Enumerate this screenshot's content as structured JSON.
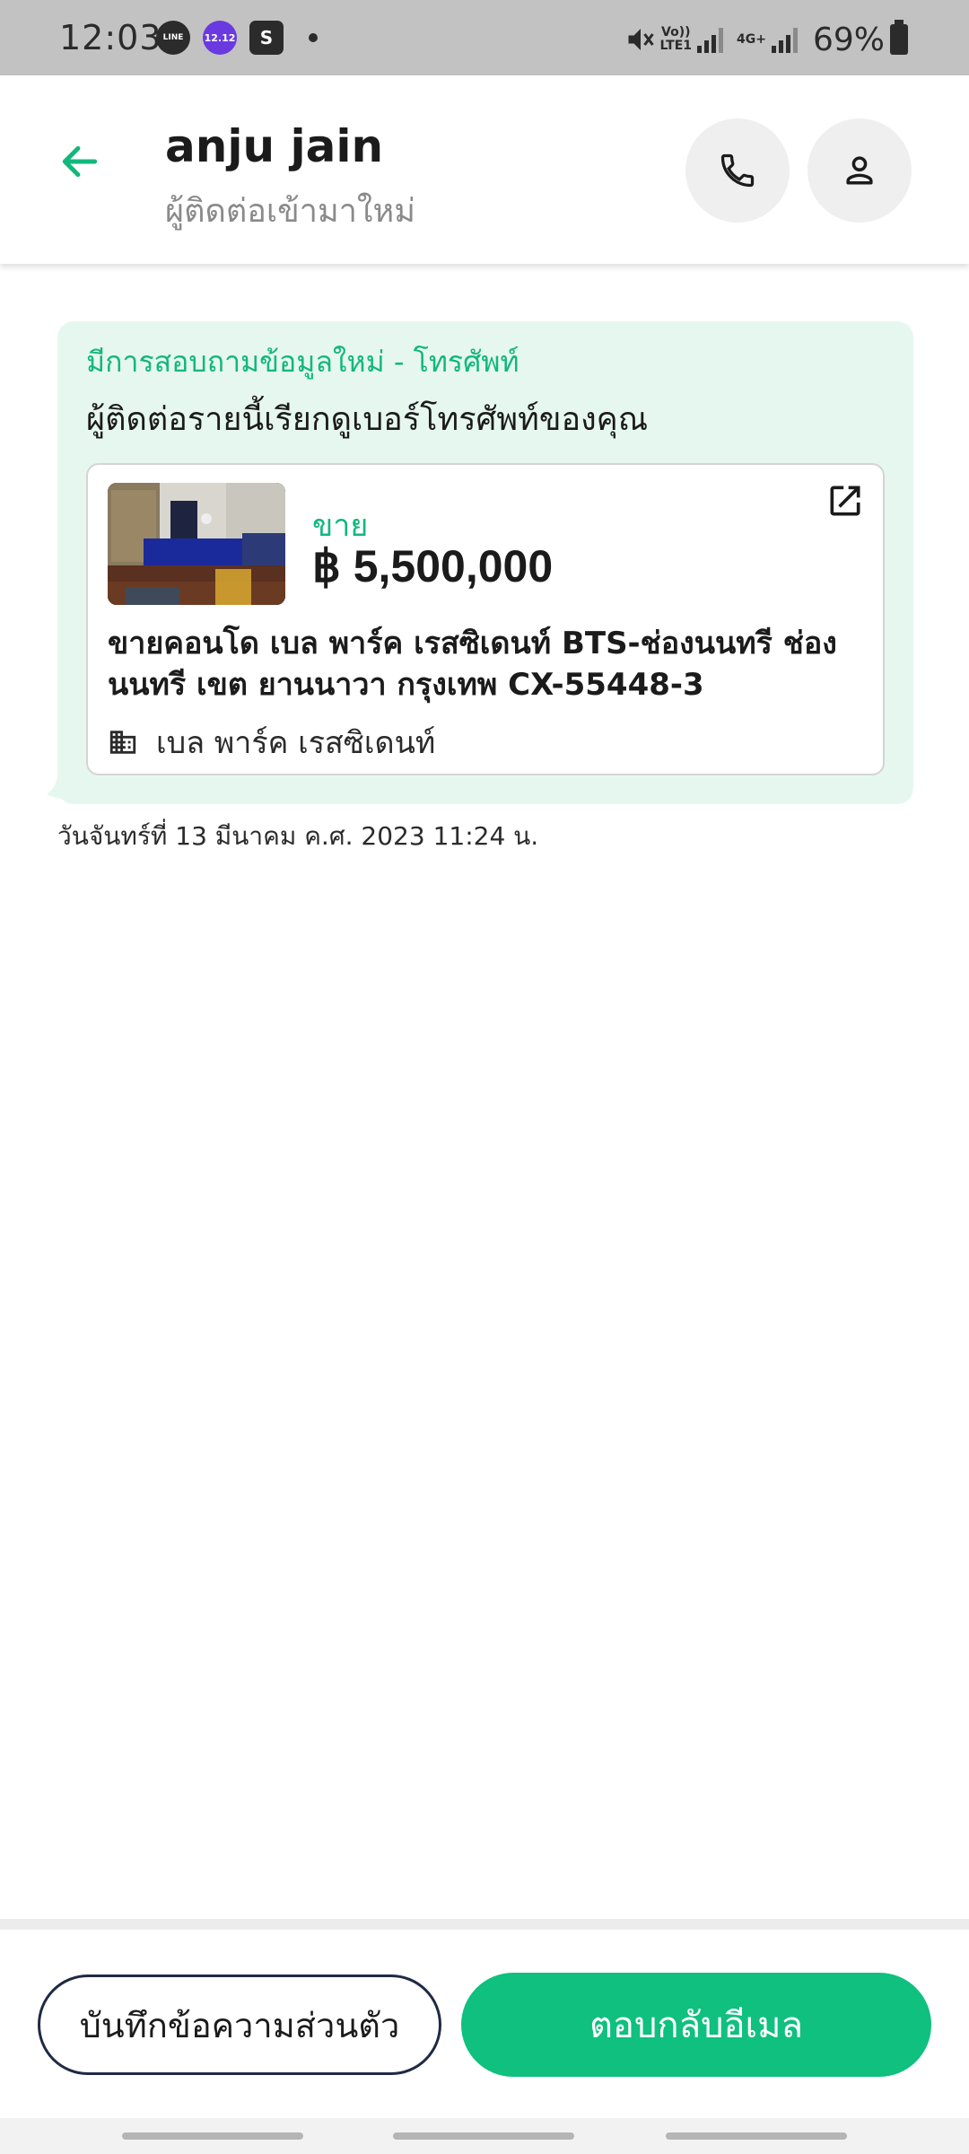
{
  "status_bar": {
    "time": "12:03",
    "notifications": [
      "LINE",
      "12.12",
      "S"
    ],
    "volte_label": "Vo))",
    "lte_label": "LTE1",
    "network_label": "4G+",
    "battery": "69%"
  },
  "header": {
    "contact_name": "anju jain",
    "subtitle": "ผู้ติดต่อเข้ามาใหม่"
  },
  "inquiry": {
    "title": "มีการสอบถามข้อมูลใหม่ - โทรศัพท์",
    "message": "ผู้ติดต่อรายนี้เรียกดูเบอร์โทรศัพท์ของคุณ",
    "listing": {
      "transaction_type": "ขาย",
      "price": "฿ 5,500,000",
      "title": "ขายคอนโด  เบล พาร์ค เรสซิเดนท์ BTS-ช่องนนทรี ช่องนนทรี เขต ยานนาวา กรุงเทพ CX-55448-3",
      "project_name": "เบล พาร์ค เรสซิเดนท์"
    },
    "timestamp": "วันจันทร์ที่ 13 มีนาคม ค.ศ. 2023 11:24 น."
  },
  "actions": {
    "private_note_label": "บันทึกข้อความส่วนตัว",
    "reply_email_label": "ตอบกลับอีเมล"
  },
  "colors": {
    "accent": "#0fc07f",
    "bubble": "#e6f7f0",
    "outline": "#1f2a44"
  },
  "icons": {
    "back": "arrow-left-icon",
    "call": "phone-icon",
    "profile": "person-icon",
    "external": "open-external-icon",
    "project": "building-icon"
  }
}
